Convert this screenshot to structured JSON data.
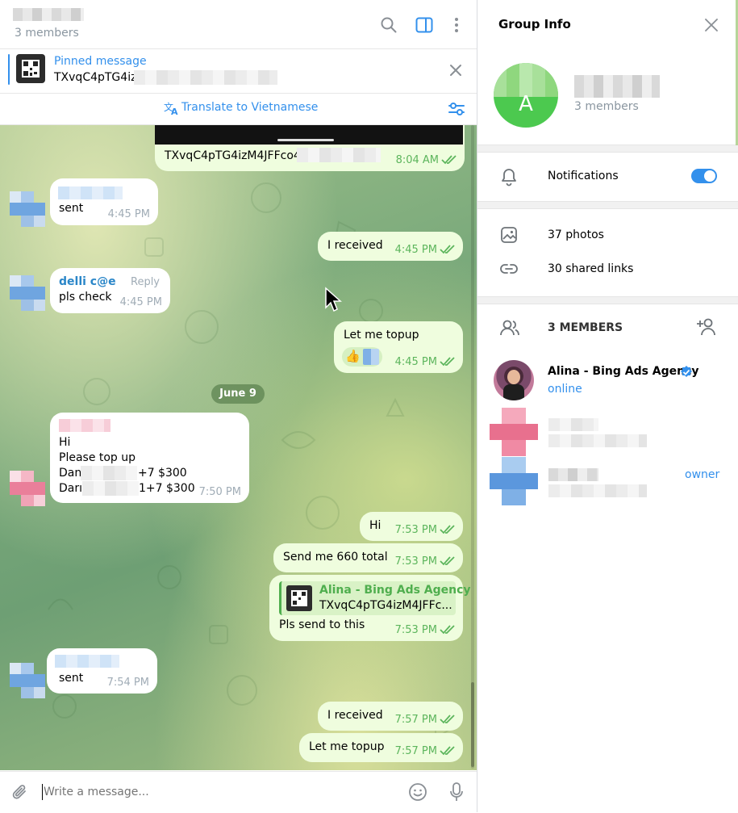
{
  "header": {
    "members_label": "3 members"
  },
  "pinned": {
    "title": "Pinned message",
    "text": "TXvqC4pTG4izl"
  },
  "translate": {
    "label": "Translate to Vietnamese"
  },
  "messages": {
    "m1": {
      "text": "TXvqC4pTG4izM4JFFco4etS",
      "time": "8:04 AM"
    },
    "m2": {
      "text": "sent",
      "time": "4:45 PM"
    },
    "m3": {
      "text": "I received",
      "time": "4:45 PM"
    },
    "m4": {
      "sender": "delli c@e",
      "reply": "Reply",
      "text": "pls check",
      "time": "4:45 PM"
    },
    "m5": {
      "text": "Let me topup",
      "reaction": "👍",
      "time": "4:45 PM"
    },
    "date": "June 9",
    "m6": {
      "line1": "Hi",
      "line2": "Please top up",
      "line3a": "Dan",
      "line3b": "+7  $300",
      "line4a": "Darı",
      "line4b": "1+7  $300",
      "time": "7:50 PM"
    },
    "m7": {
      "text": "Hi",
      "time": "7:53 PM"
    },
    "m8": {
      "text": "Send me 660 total",
      "time": "7:53 PM"
    },
    "m9": {
      "quote_sender": "Alina - Bing Ads Agency",
      "quote_text": "TXvqC4pTG4izM4JFFc...",
      "text": "Pls send to this",
      "time": "7:53 PM"
    },
    "m10": {
      "text": "sent",
      "time": "7:54 PM"
    },
    "m11": {
      "text": "I received",
      "time": "7:57 PM"
    },
    "m12": {
      "text": "Let me topup",
      "time": "7:57 PM"
    }
  },
  "composer": {
    "placeholder": "Write a message..."
  },
  "info": {
    "title": "Group Info",
    "avatar_letter": "A",
    "members_label": "3 members",
    "notifications_label": "Notifications",
    "notifications_on": true,
    "photos_label": "37 photos",
    "links_label": "30 shared links",
    "members_header": "3 MEMBERS",
    "member1_name": "Alina - Bing Ads Agency",
    "member1_status": "online",
    "member3_role": "owner"
  },
  "colors": {
    "accent": "#3390ec",
    "link_blue": "#2a86c8",
    "out_bubble": "#effdde",
    "time_green": "#5cb55c",
    "sender_green": "#4fae4e"
  }
}
